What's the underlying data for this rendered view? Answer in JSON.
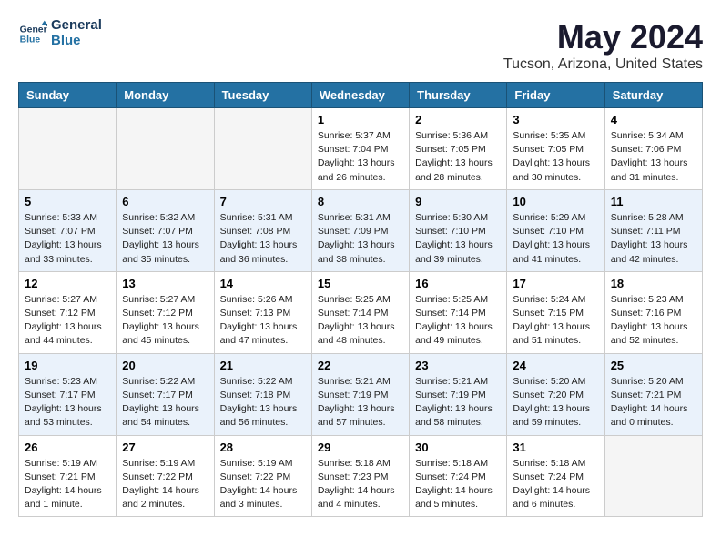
{
  "logo": {
    "line1": "General",
    "line2": "Blue"
  },
  "title": "May 2024",
  "subtitle": "Tucson, Arizona, United States",
  "days": [
    "Sunday",
    "Monday",
    "Tuesday",
    "Wednesday",
    "Thursday",
    "Friday",
    "Saturday"
  ],
  "weeks": [
    {
      "shaded": false,
      "cells": [
        {
          "empty": true
        },
        {
          "empty": true
        },
        {
          "empty": true
        },
        {
          "date": "1",
          "sunrise": "5:37 AM",
          "sunset": "7:04 PM",
          "daylight": "13 hours and 26 minutes."
        },
        {
          "date": "2",
          "sunrise": "5:36 AM",
          "sunset": "7:05 PM",
          "daylight": "13 hours and 28 minutes."
        },
        {
          "date": "3",
          "sunrise": "5:35 AM",
          "sunset": "7:05 PM",
          "daylight": "13 hours and 30 minutes."
        },
        {
          "date": "4",
          "sunrise": "5:34 AM",
          "sunset": "7:06 PM",
          "daylight": "13 hours and 31 minutes."
        }
      ]
    },
    {
      "shaded": true,
      "cells": [
        {
          "date": "5",
          "sunrise": "5:33 AM",
          "sunset": "7:07 PM",
          "daylight": "13 hours and 33 minutes."
        },
        {
          "date": "6",
          "sunrise": "5:32 AM",
          "sunset": "7:07 PM",
          "daylight": "13 hours and 35 minutes."
        },
        {
          "date": "7",
          "sunrise": "5:31 AM",
          "sunset": "7:08 PM",
          "daylight": "13 hours and 36 minutes."
        },
        {
          "date": "8",
          "sunrise": "5:31 AM",
          "sunset": "7:09 PM",
          "daylight": "13 hours and 38 minutes."
        },
        {
          "date": "9",
          "sunrise": "5:30 AM",
          "sunset": "7:10 PM",
          "daylight": "13 hours and 39 minutes."
        },
        {
          "date": "10",
          "sunrise": "5:29 AM",
          "sunset": "7:10 PM",
          "daylight": "13 hours and 41 minutes."
        },
        {
          "date": "11",
          "sunrise": "5:28 AM",
          "sunset": "7:11 PM",
          "daylight": "13 hours and 42 minutes."
        }
      ]
    },
    {
      "shaded": false,
      "cells": [
        {
          "date": "12",
          "sunrise": "5:27 AM",
          "sunset": "7:12 PM",
          "daylight": "13 hours and 44 minutes."
        },
        {
          "date": "13",
          "sunrise": "5:27 AM",
          "sunset": "7:12 PM",
          "daylight": "13 hours and 45 minutes."
        },
        {
          "date": "14",
          "sunrise": "5:26 AM",
          "sunset": "7:13 PM",
          "daylight": "13 hours and 47 minutes."
        },
        {
          "date": "15",
          "sunrise": "5:25 AM",
          "sunset": "7:14 PM",
          "daylight": "13 hours and 48 minutes."
        },
        {
          "date": "16",
          "sunrise": "5:25 AM",
          "sunset": "7:14 PM",
          "daylight": "13 hours and 49 minutes."
        },
        {
          "date": "17",
          "sunrise": "5:24 AM",
          "sunset": "7:15 PM",
          "daylight": "13 hours and 51 minutes."
        },
        {
          "date": "18",
          "sunrise": "5:23 AM",
          "sunset": "7:16 PM",
          "daylight": "13 hours and 52 minutes."
        }
      ]
    },
    {
      "shaded": true,
      "cells": [
        {
          "date": "19",
          "sunrise": "5:23 AM",
          "sunset": "7:17 PM",
          "daylight": "13 hours and 53 minutes."
        },
        {
          "date": "20",
          "sunrise": "5:22 AM",
          "sunset": "7:17 PM",
          "daylight": "13 hours and 54 minutes."
        },
        {
          "date": "21",
          "sunrise": "5:22 AM",
          "sunset": "7:18 PM",
          "daylight": "13 hours and 56 minutes."
        },
        {
          "date": "22",
          "sunrise": "5:21 AM",
          "sunset": "7:19 PM",
          "daylight": "13 hours and 57 minutes."
        },
        {
          "date": "23",
          "sunrise": "5:21 AM",
          "sunset": "7:19 PM",
          "daylight": "13 hours and 58 minutes."
        },
        {
          "date": "24",
          "sunrise": "5:20 AM",
          "sunset": "7:20 PM",
          "daylight": "13 hours and 59 minutes."
        },
        {
          "date": "25",
          "sunrise": "5:20 AM",
          "sunset": "7:21 PM",
          "daylight": "14 hours and 0 minutes."
        }
      ]
    },
    {
      "shaded": false,
      "cells": [
        {
          "date": "26",
          "sunrise": "5:19 AM",
          "sunset": "7:21 PM",
          "daylight": "14 hours and 1 minute."
        },
        {
          "date": "27",
          "sunrise": "5:19 AM",
          "sunset": "7:22 PM",
          "daylight": "14 hours and 2 minutes."
        },
        {
          "date": "28",
          "sunrise": "5:19 AM",
          "sunset": "7:22 PM",
          "daylight": "14 hours and 3 minutes."
        },
        {
          "date": "29",
          "sunrise": "5:18 AM",
          "sunset": "7:23 PM",
          "daylight": "14 hours and 4 minutes."
        },
        {
          "date": "30",
          "sunrise": "5:18 AM",
          "sunset": "7:24 PM",
          "daylight": "14 hours and 5 minutes."
        },
        {
          "date": "31",
          "sunrise": "5:18 AM",
          "sunset": "7:24 PM",
          "daylight": "14 hours and 6 minutes."
        },
        {
          "empty": true
        }
      ]
    }
  ],
  "labels": {
    "sunrise_prefix": "Sunrise: ",
    "sunset_prefix": "Sunset: ",
    "daylight_prefix": "Daylight: "
  }
}
